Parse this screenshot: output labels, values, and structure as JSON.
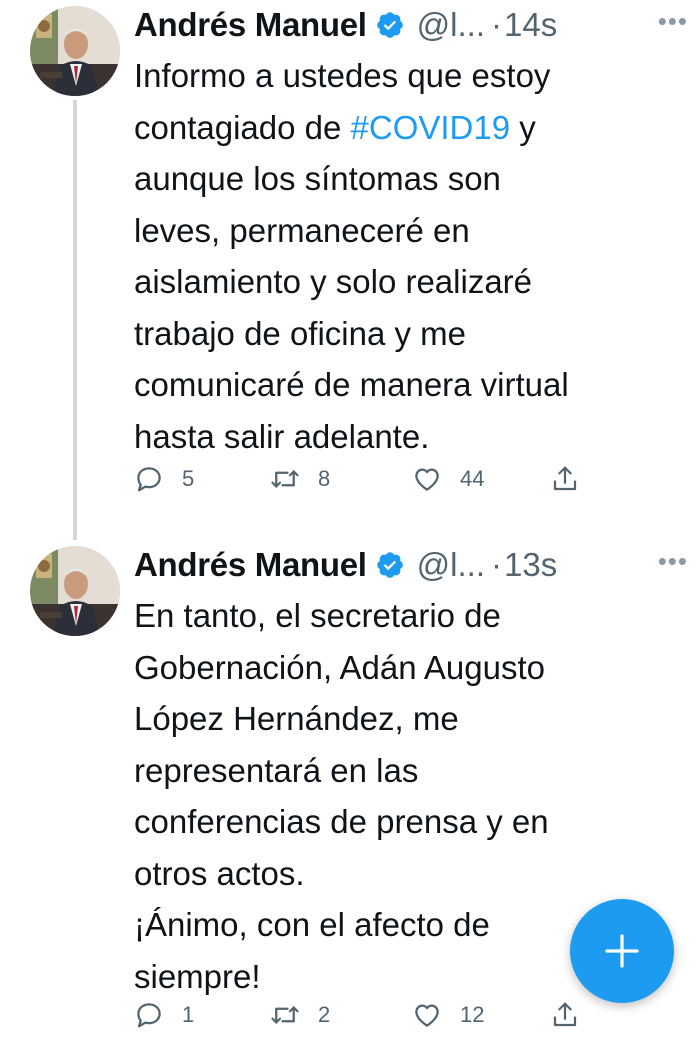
{
  "thread": {
    "tweets": [
      {
        "author_name": "Andrés Manuel",
        "handle": "@l...",
        "dot": "·",
        "time": "14s",
        "more_icon": "more-horizontal-icon",
        "text_lines": [
          "Informo a ustedes que estoy",
          "contagiado de ",
          "aunque los síntomas son",
          "leves, permaneceré en",
          "aislamiento y solo realizaré",
          "trabajo de oficina y me",
          "comunicaré de manera virtual",
          "hasta salir adelante."
        ],
        "hashtag": "#COVID19",
        "hashtag_suffix": " y",
        "replies": "5",
        "retweets": "8",
        "likes": "44"
      },
      {
        "author_name": "Andrés Manuel",
        "handle": "@l...",
        "dot": "·",
        "time": "13s",
        "more_icon": "more-horizontal-icon",
        "text_lines": [
          "En tanto, el secretario de",
          "Gobernación, Adán Augusto",
          "López Hernández, me",
          "representará en las",
          "conferencias de prensa y en",
          "otros actos.",
          "¡Ánimo, con el afecto de",
          "siempre!"
        ],
        "replies": "1",
        "retweets": "2",
        "likes": "12"
      }
    ]
  },
  "compose_button": {
    "icon": "plus-icon"
  },
  "colors": {
    "accent": "#1d9bf0",
    "text": "#0f1419",
    "secondary_text": "#536471",
    "thread_line": "#cfd9de"
  }
}
